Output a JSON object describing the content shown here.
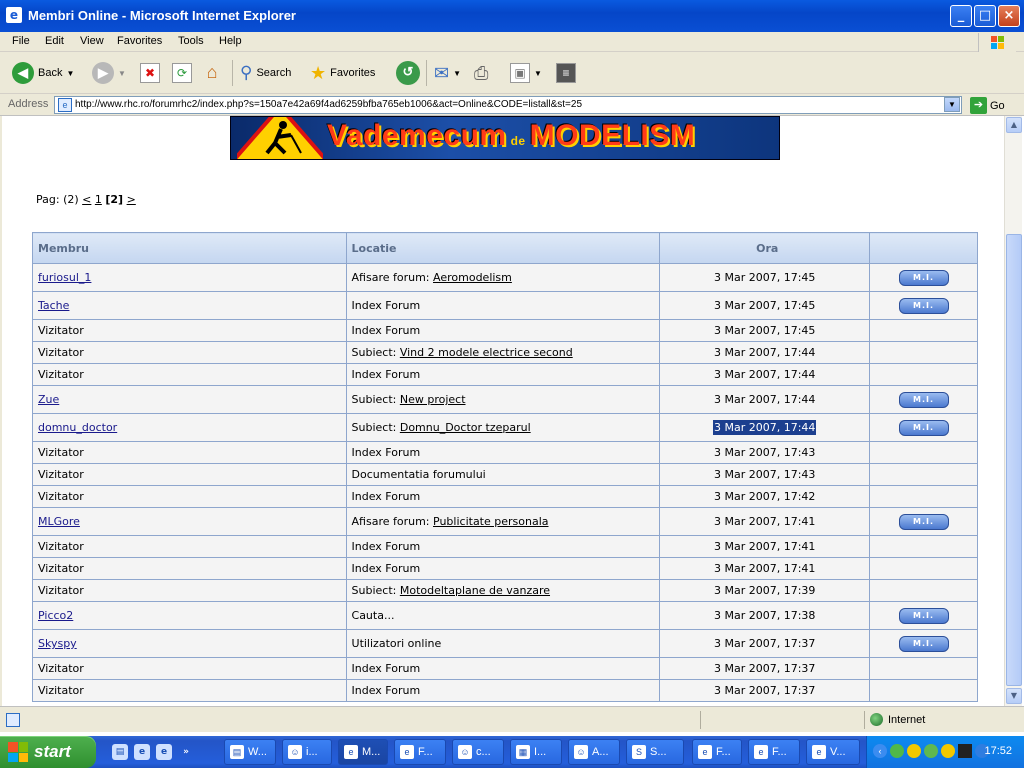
{
  "window": {
    "title": "Membri Online - Microsoft Internet Explorer"
  },
  "menu": [
    "File",
    "Edit",
    "View",
    "Favorites",
    "Tools",
    "Help"
  ],
  "toolbar": {
    "back_label": "Back",
    "search_label": "Search",
    "favorites_label": "Favorites"
  },
  "address": {
    "label": "Address",
    "url": "http://www.rhc.ro/forumrhc2/index.php?s=150a7e42a69f4ad6259bfba765eb1006&act=Online&CODE=listall&st=25",
    "go_label": "Go"
  },
  "banner": {
    "title_main": "Vademecum",
    "title_mid": "de",
    "title_end": "MODELISM"
  },
  "pagination": {
    "prefix": "Pag: (2)",
    "prev": "<",
    "page1": "1",
    "current": "[2]",
    "next": ">"
  },
  "table": {
    "headers": {
      "member": "Membru",
      "location": "Locatie",
      "time": "Ora"
    },
    "mi_label": "M.I.",
    "rows": [
      {
        "member": "furiosul_1",
        "loc_prefix": "Afisare forum: ",
        "loc_link": "Aeromodelism",
        "time": "3 Mar 2007, 17:45"
      },
      {
        "member": "Tache",
        "loc_prefix": "Index Forum",
        "loc_link": "",
        "time": "3 Mar 2007, 17:45"
      },
      {
        "member": "Vizitator",
        "loc_prefix": "Index Forum",
        "loc_link": "",
        "time": "3 Mar 2007, 17:45"
      },
      {
        "member": "Vizitator",
        "loc_prefix": "Subiect: ",
        "loc_link": "Vind 2 modele electrice second",
        "time": "3 Mar 2007, 17:44"
      },
      {
        "member": "Vizitator",
        "loc_prefix": "Index Forum",
        "loc_link": "",
        "time": "3 Mar 2007, 17:44"
      },
      {
        "member": "Zue",
        "loc_prefix": "Subiect: ",
        "loc_link": "New project",
        "time": "3 Mar 2007, 17:44"
      },
      {
        "member": "domnu_doctor",
        "loc_prefix": "Subiect: ",
        "loc_link": "Domnu_Doctor tzeparul",
        "time": "3 Mar 2007, 17:44"
      },
      {
        "member": "Vizitator",
        "loc_prefix": "Index Forum",
        "loc_link": "",
        "time": "3 Mar 2007, 17:43"
      },
      {
        "member": "Vizitator",
        "loc_prefix": "Documentatia forumului",
        "loc_link": "",
        "time": "3 Mar 2007, 17:43"
      },
      {
        "member": "Vizitator",
        "loc_prefix": "Index Forum",
        "loc_link": "",
        "time": "3 Mar 2007, 17:42"
      },
      {
        "member": "MLGore",
        "loc_prefix": "Afisare forum: ",
        "loc_link": "Publicitate personala",
        "time": "3 Mar 2007, 17:41"
      },
      {
        "member": "Vizitator",
        "loc_prefix": "Index Forum",
        "loc_link": "",
        "time": "3 Mar 2007, 17:41"
      },
      {
        "member": "Vizitator",
        "loc_prefix": "Index Forum",
        "loc_link": "",
        "time": "3 Mar 2007, 17:41"
      },
      {
        "member": "Vizitator",
        "loc_prefix": "Subiect: ",
        "loc_link": "Motodeltaplane de vanzare",
        "time": "3 Mar 2007, 17:39"
      },
      {
        "member": "Picco2",
        "loc_prefix": "Cauta...",
        "loc_link": "",
        "time": "3 Mar 2007, 17:38"
      },
      {
        "member": "Skyspy",
        "loc_prefix": "Utilizatori online",
        "loc_link": "",
        "time": "3 Mar 2007, 17:37"
      },
      {
        "member": "Vizitator",
        "loc_prefix": "Index Forum",
        "loc_link": "",
        "time": "3 Mar 2007, 17:37"
      },
      {
        "member": "Vizitator",
        "loc_prefix": "Index Forum",
        "loc_link": "",
        "time": "3 Mar 2007, 17:37"
      }
    ]
  },
  "status": {
    "zone": "Internet"
  },
  "taskbar": {
    "start_label": "start",
    "tasks": [
      "W...",
      "i...",
      "M...",
      "F...",
      "c...",
      "I...",
      "A...",
      "S...",
      "F...",
      "F...",
      "V..."
    ],
    "clock": "17:52"
  }
}
